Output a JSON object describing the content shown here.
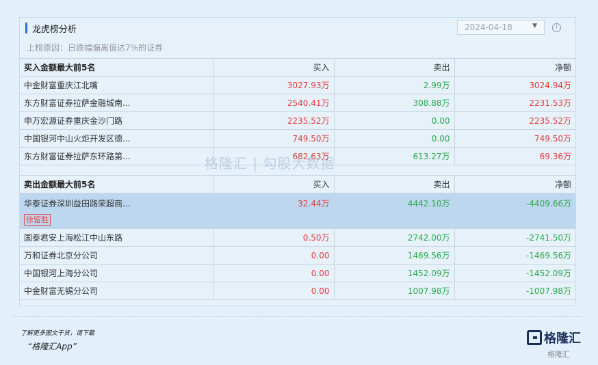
{
  "header": {
    "title": "龙虎榜分析",
    "date": "2024-04-18",
    "reason": "上榜原因：日跌幅偏离值达7%的证券"
  },
  "buy_table": {
    "headers": [
      "买入金额最大前5名",
      "买入",
      "卖出",
      "净额"
    ],
    "rows": [
      {
        "name": "中金财富重庆江北嘴",
        "buy": "3027.93万",
        "sell": "2.99万",
        "net": "3024.94万"
      },
      {
        "name": "东方财富证券拉萨金融城南...",
        "buy": "2540.41万",
        "sell": "308.88万",
        "net": "2231.53万"
      },
      {
        "name": "申万宏源证券重庆金沙门路",
        "buy": "2235.52万",
        "sell": "0.00",
        "net": "2235.52万"
      },
      {
        "name": "中国银河中山火炬开发区德...",
        "buy": "749.50万",
        "sell": "0.00",
        "net": "749.50万"
      },
      {
        "name": "东方财富证券拉萨东环路第...",
        "buy": "682.63万",
        "sell": "613.27万",
        "net": "69.36万"
      }
    ]
  },
  "sell_table": {
    "headers": [
      "卖出金额最大前5名",
      "买入",
      "卖出",
      "净额"
    ],
    "rows": [
      {
        "name": "华泰证券深圳益田路荣超商...",
        "tag": "徐留胜",
        "buy": "32.44万",
        "sell": "4442.10万",
        "net": "-4409.66万"
      },
      {
        "name": "国泰君安上海松江中山东路",
        "buy": "0.50万",
        "sell": "2742.00万",
        "net": "-2741.50万"
      },
      {
        "name": "万和证券北京分公司",
        "buy": "0.00",
        "sell": "1469.56万",
        "net": "-1469.56万"
      },
      {
        "name": "中国银河上海分公司",
        "buy": "0.00",
        "sell": "1452.09万",
        "net": "-1452.09万"
      },
      {
        "name": "中金财富无锡分公司",
        "buy": "0.00",
        "sell": "1007.98万",
        "net": "-1007.98万"
      }
    ]
  },
  "watermark": "格隆汇 | 勾股大数据",
  "footer": {
    "line1": "了解更多图文干货，请下载",
    "line2": "“格隆汇App”",
    "logo": "格隆汇",
    "corner": "格隆汇"
  },
  "colors": {
    "positive": "#e43a3a",
    "negative": "#2aa84a",
    "highlight": "#bed7f0",
    "accent": "#2c6fd1"
  }
}
